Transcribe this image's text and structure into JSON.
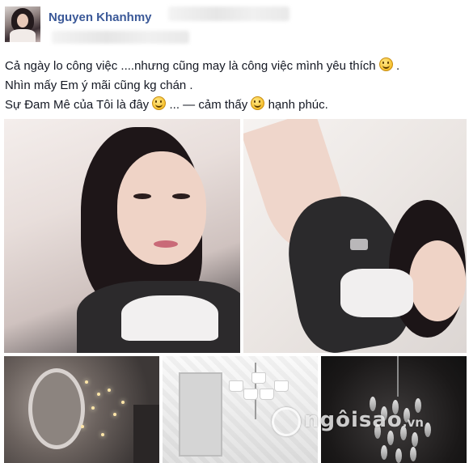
{
  "post": {
    "author": "Nguyen Khanhmy",
    "lines": [
      {
        "text": "Cả ngày lo công việc ....nhưng cũng may là công việc mình yêu thích",
        "suffix": " ."
      },
      {
        "text": "Nhìn mấy Em ý mãi cũng kg chán .",
        "suffix": ""
      },
      {
        "text_a": "Sự Đam Mê của Tôi là đây",
        "text_b": " ... — cảm thấy",
        "text_c": " hạnh phúc."
      }
    ],
    "emoticons": [
      "smile-emoticon",
      "grin-emoticon",
      "happy-emoticon"
    ]
  },
  "watermark": {
    "text": "ngôisao",
    "suffix": ".vn"
  },
  "colors": {
    "author_link": "#3b5998",
    "body_text": "#141823"
  }
}
